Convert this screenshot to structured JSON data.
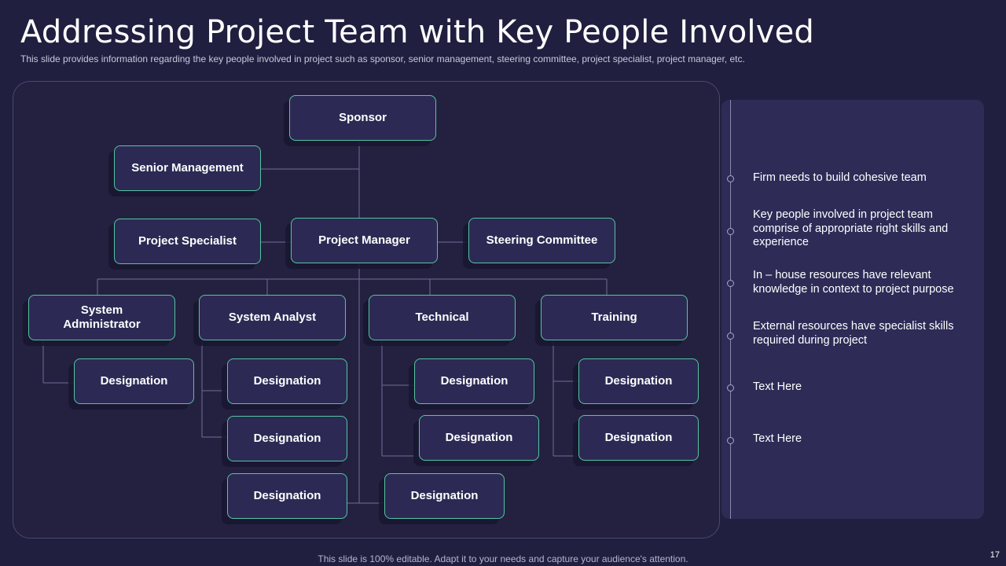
{
  "title": "Addressing Project Team with Key People Involved",
  "subtitle": "This slide provides  information  regarding  the key people involved  in project such as sponsor, senior management, steering committee, project specialist, project manager,  etc.",
  "org_chart": {
    "sponsor": "Sponsor",
    "senior_management": "Senior Management",
    "project_specialist": "Project Specialist",
    "project_manager": "Project Manager",
    "steering_committee": "Steering Committee",
    "system_administrator": "System Administrator",
    "system_analyst": "System Analyst",
    "technical": "Technical",
    "training": "Training",
    "designation": "Designation"
  },
  "side_points": [
    "Firm needs to build cohesive team",
    "Key people involved in project team comprise of appropriate right skills and experience",
    "In – house resources have relevant knowledge in context to project purpose",
    "External resources have specialist skills required during project",
    "Text Here",
    "Text Here"
  ],
  "footer": "This slide is 100% editable. Adapt it to your needs and capture your audience's attention.",
  "page_number": "17",
  "colors": {
    "background": "#211f3f",
    "node_border": "#55c4a2",
    "node_fill": "#2c2a54",
    "connector": "#8a88b0"
  }
}
